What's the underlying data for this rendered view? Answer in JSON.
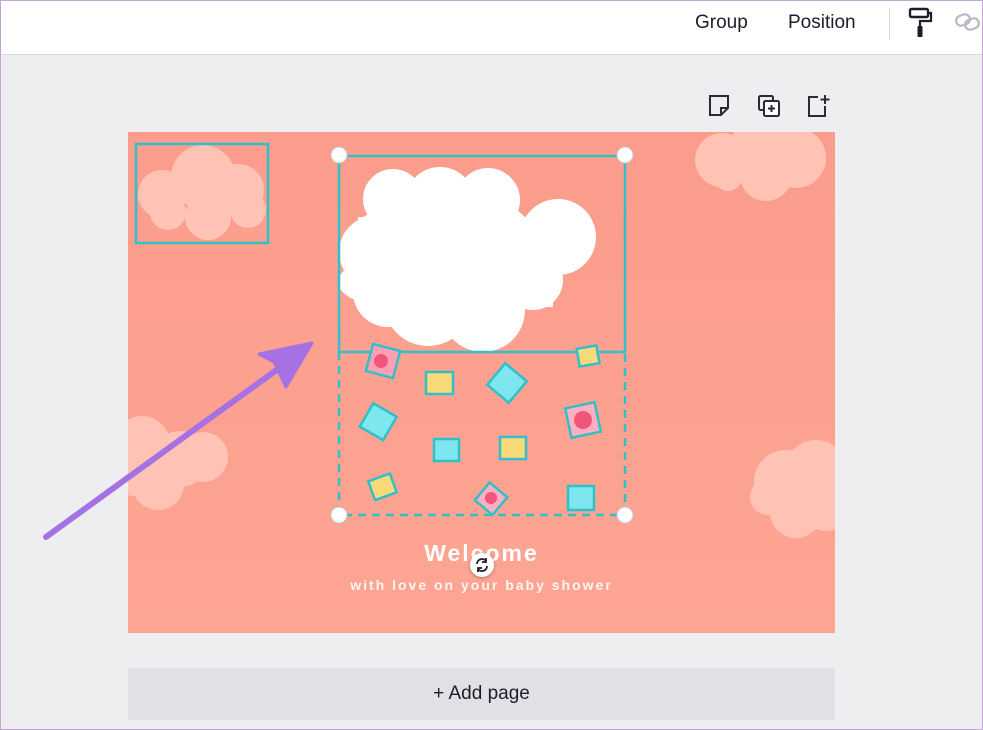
{
  "toolbar": {
    "group_label": "Group",
    "position_label": "Position",
    "icons": [
      "paint-roller-icon",
      "link-icon"
    ]
  },
  "page_actions": {
    "icons": [
      "note-icon",
      "duplicate-page-icon",
      "add-page-icon"
    ]
  },
  "design": {
    "title": "Welcome",
    "subtitle": "with love on your baby shower",
    "colors": {
      "background": "#fb9c8c",
      "selection": "#2fc1c9",
      "cloud_white": "#ffffff",
      "cloud_pink": "#ffc3b6",
      "box_yellow": "#f9d97a",
      "box_cyan": "#7de6ef",
      "heart_pink": "#f0557a"
    }
  },
  "add_page_label": "+ Add page",
  "annotation": {
    "arrow_color": "#a571e3"
  }
}
